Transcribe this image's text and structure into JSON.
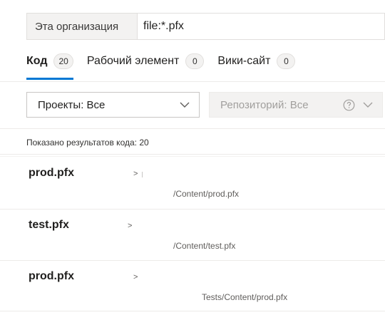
{
  "search": {
    "scope_label": "Эта организация",
    "query_value": "file:*.pfx"
  },
  "tabs": [
    {
      "label": "Код",
      "count": "20",
      "active": true
    },
    {
      "label": "Рабочий элемент",
      "count": "0",
      "active": false
    },
    {
      "label": "Вики-сайт",
      "count": "0",
      "active": false
    }
  ],
  "filters": {
    "projects_label": "Проекты: Все",
    "repository_label": "Репозиторий: Все"
  },
  "summary_text": "Показано результатов кода: 20",
  "results": [
    {
      "name": "prod.pfx",
      "separator": ">",
      "path": "/Content/prod.pfx"
    },
    {
      "name": "test.pfx",
      "separator": ">",
      "path": "/Content/test.pfx"
    },
    {
      "name": "prod.pfx",
      "separator": ">",
      "path": "Tests/Content/prod.pfx"
    }
  ],
  "icons": {
    "chevron": "chevron-down-icon",
    "help": "help-icon"
  },
  "colors": {
    "accent": "#0078d4"
  }
}
